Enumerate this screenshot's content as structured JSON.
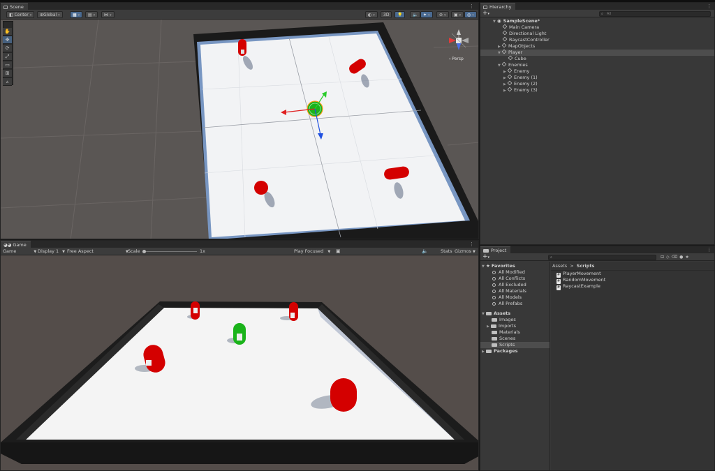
{
  "scene": {
    "tab_label": "Scene",
    "pivot_label": "Center",
    "space_label": "Global",
    "mode_2d_label": "3D",
    "persp_label": "‹ Persp"
  },
  "game": {
    "tab_label": "Game",
    "display_mode": "Game",
    "display": "Display 1",
    "aspect": "Free Aspect",
    "scale_label": "Scale",
    "scale_value": "1x",
    "play_mode": "Play Focused",
    "stats_label": "Stats",
    "gizmos_label": "Gizmos"
  },
  "hierarchy": {
    "tab_label": "Hierarchy",
    "search_placeholder": "All",
    "items": [
      {
        "label": "SampleScene*",
        "depth": 0,
        "kind": "scene",
        "expanded": true
      },
      {
        "label": "Main Camera",
        "depth": 1,
        "kind": "object"
      },
      {
        "label": "Directional Light",
        "depth": 1,
        "kind": "object"
      },
      {
        "label": "RaycastController",
        "depth": 1,
        "kind": "object"
      },
      {
        "label": "MapObjects",
        "depth": 1,
        "kind": "object",
        "collapsed": true
      },
      {
        "label": "Player",
        "depth": 1,
        "kind": "object",
        "expanded": true,
        "selected": true
      },
      {
        "label": "Cube",
        "depth": 2,
        "kind": "object"
      },
      {
        "label": "Enemies",
        "depth": 1,
        "kind": "object",
        "expanded": true
      },
      {
        "label": "Enemy",
        "depth": 2,
        "kind": "object",
        "collapsed": true
      },
      {
        "label": "Enemy (1)",
        "depth": 2,
        "kind": "object",
        "collapsed": true
      },
      {
        "label": "Enemy (2)",
        "depth": 2,
        "kind": "object",
        "collapsed": true
      },
      {
        "label": "Enemy (3)",
        "depth": 2,
        "kind": "object",
        "collapsed": true
      }
    ]
  },
  "project": {
    "tab_label": "Project",
    "breadcrumb_root": "Assets",
    "breadcrumb_sep": ">",
    "breadcrumb_current": "Scripts",
    "favorites_label": "Favorites",
    "favorites": [
      "All Modified",
      "All Conflicts",
      "All Excluded",
      "All Materials",
      "All Models",
      "All Prefabs"
    ],
    "assets_label": "Assets",
    "assets": [
      {
        "label": "Images",
        "arrow": false
      },
      {
        "label": "Imports",
        "arrow": true
      },
      {
        "label": "Materials",
        "arrow": false
      },
      {
        "label": "Scenes",
        "arrow": false
      },
      {
        "label": "Scripts",
        "arrow": false,
        "selected": true
      }
    ],
    "packages_label": "Packages",
    "files": [
      "PlayerMovement",
      "RandomMovement",
      "RaycastExample"
    ]
  },
  "colors": {
    "enemy": "#d40000",
    "player": "#1ab31a",
    "selection": "#46607e"
  },
  "icons": {
    "scene_tools": [
      "hand-icon",
      "move-icon",
      "rotate-icon",
      "scale-icon",
      "rect-icon",
      "transform-icon",
      "custom-tool-icon"
    ]
  }
}
